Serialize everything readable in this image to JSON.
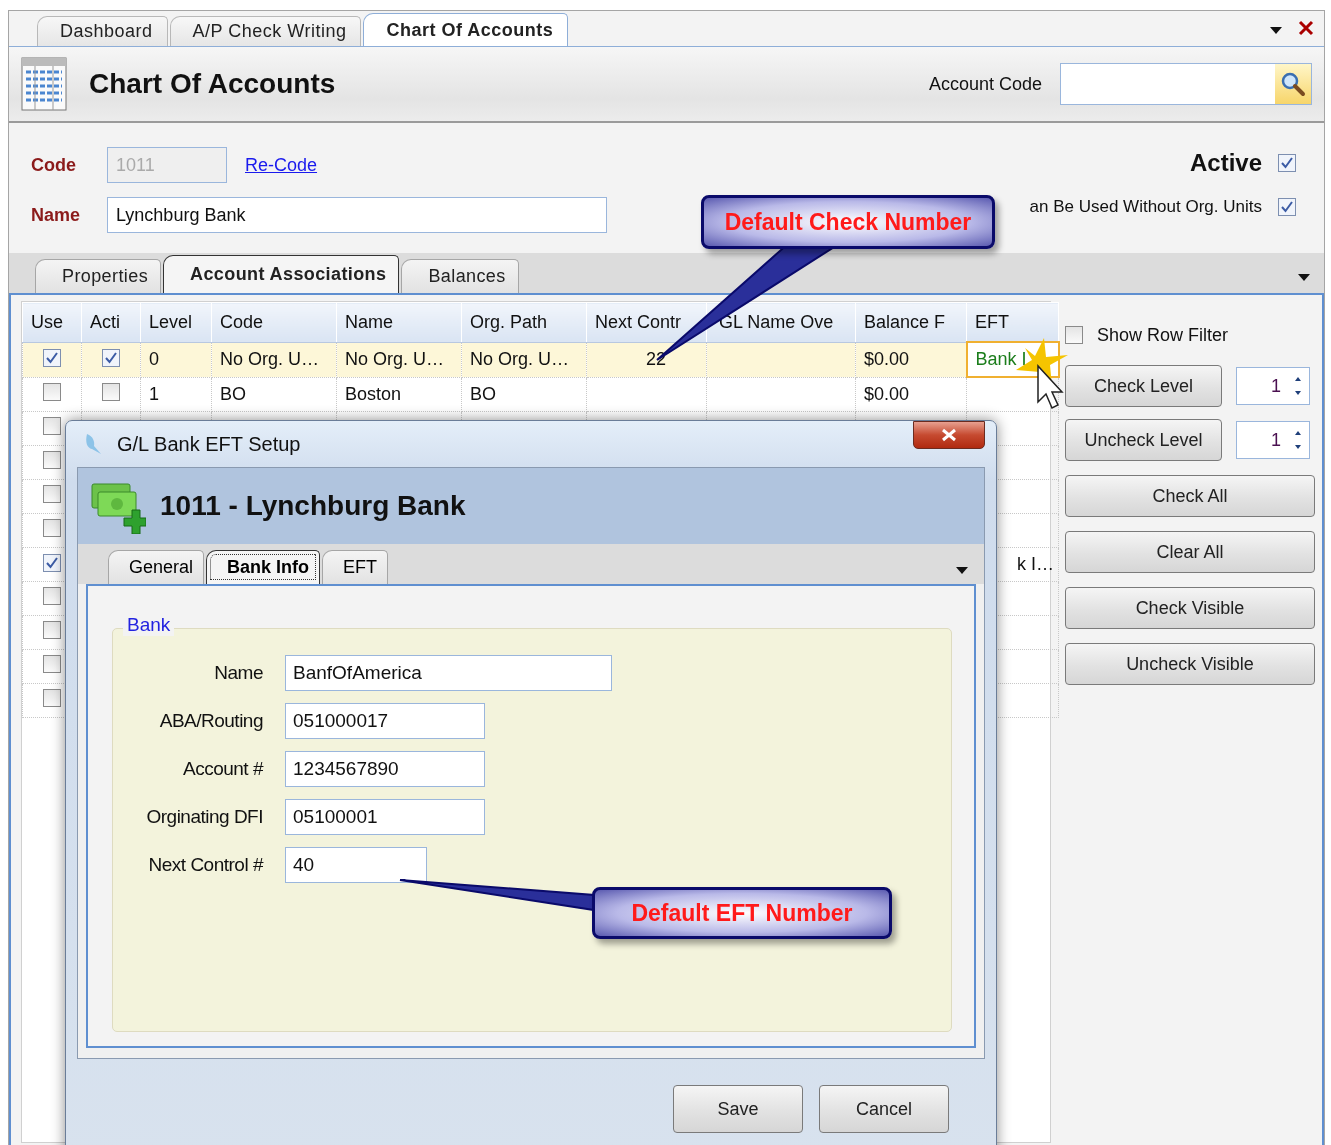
{
  "doc_tabs": [
    {
      "label": "Dashboard",
      "selected": false
    },
    {
      "label": "A/P Check Writing",
      "selected": false
    },
    {
      "label": "Chart Of Accounts",
      "selected": true
    }
  ],
  "header": {
    "title": "Chart Of Accounts",
    "search_label": "Account Code"
  },
  "form": {
    "code_label": "Code",
    "code_value": "1011",
    "code_disabled": true,
    "recode_link": "Re-Code",
    "name_label": "Name",
    "name_value": "Lynchburg Bank",
    "active": {
      "label": "Active",
      "checked": true
    },
    "without_org": {
      "label": "an Be Used Without Org. Units",
      "checked": true
    }
  },
  "section_tabs": [
    {
      "label": "Properties",
      "selected": false
    },
    {
      "label": "Account Associations",
      "selected": true
    },
    {
      "label": "Balances",
      "selected": false
    }
  ],
  "grid": {
    "columns": [
      "Use",
      "Acti",
      "Level",
      "Code",
      "Name",
      "Org. Path",
      "Next Contr",
      "GL Name Ove",
      "Balance F",
      "EFT"
    ],
    "rows": [
      {
        "selected": true,
        "use": true,
        "active": true,
        "level": "0",
        "code": "No Org. U…",
        "name": "No Org. U…",
        "org_path": "No Org. U…",
        "next_control": "22",
        "balance": "$0.00",
        "eft": "Bank I"
      },
      {
        "selected": false,
        "use": false,
        "active": false,
        "level": "1",
        "code": "BO",
        "name": "Boston",
        "org_path": "BO",
        "balance": "$0.00"
      },
      {
        "selected": false,
        "use": false
      },
      {
        "selected": false,
        "use": false
      },
      {
        "selected": false,
        "use": false
      },
      {
        "selected": false,
        "use": false
      },
      {
        "selected": false,
        "use": true,
        "eft": "k I…"
      },
      {
        "selected": false,
        "use": false
      },
      {
        "selected": false,
        "use": false
      },
      {
        "selected": false,
        "use": false
      },
      {
        "selected": false,
        "use": false
      }
    ]
  },
  "side_panel": {
    "show_row_filter": {
      "label": "Show Row Filter",
      "checked": false
    },
    "level_buttons": [
      {
        "label": "Check Level",
        "value": "1"
      },
      {
        "label": "Uncheck Level",
        "value": "1"
      }
    ],
    "buttons": [
      "Check All",
      "Clear All",
      "Check Visible",
      "Uncheck Visible"
    ]
  },
  "dialog": {
    "title": "G/L Bank EFT Setup",
    "heading": "1011 - Lynchburg Bank",
    "tabs": [
      {
        "label": "General",
        "selected": false
      },
      {
        "label": "Bank Info",
        "selected": true
      },
      {
        "label": "EFT",
        "selected": false
      }
    ],
    "group_title": "Bank",
    "fields": [
      {
        "label": "Name",
        "value": "BanfOfAmerica"
      },
      {
        "label": "ABA/Routing",
        "value": "051000017"
      },
      {
        "label": "Account #",
        "value": "1234567890"
      },
      {
        "label": "Orginating DFI",
        "value": "05100001"
      },
      {
        "label": "Next Control #",
        "value": "40"
      }
    ],
    "buttons": [
      "Save",
      "Cancel"
    ]
  },
  "callouts": [
    {
      "text": "Default Check Number"
    },
    {
      "text": "Default EFT Number"
    }
  ]
}
